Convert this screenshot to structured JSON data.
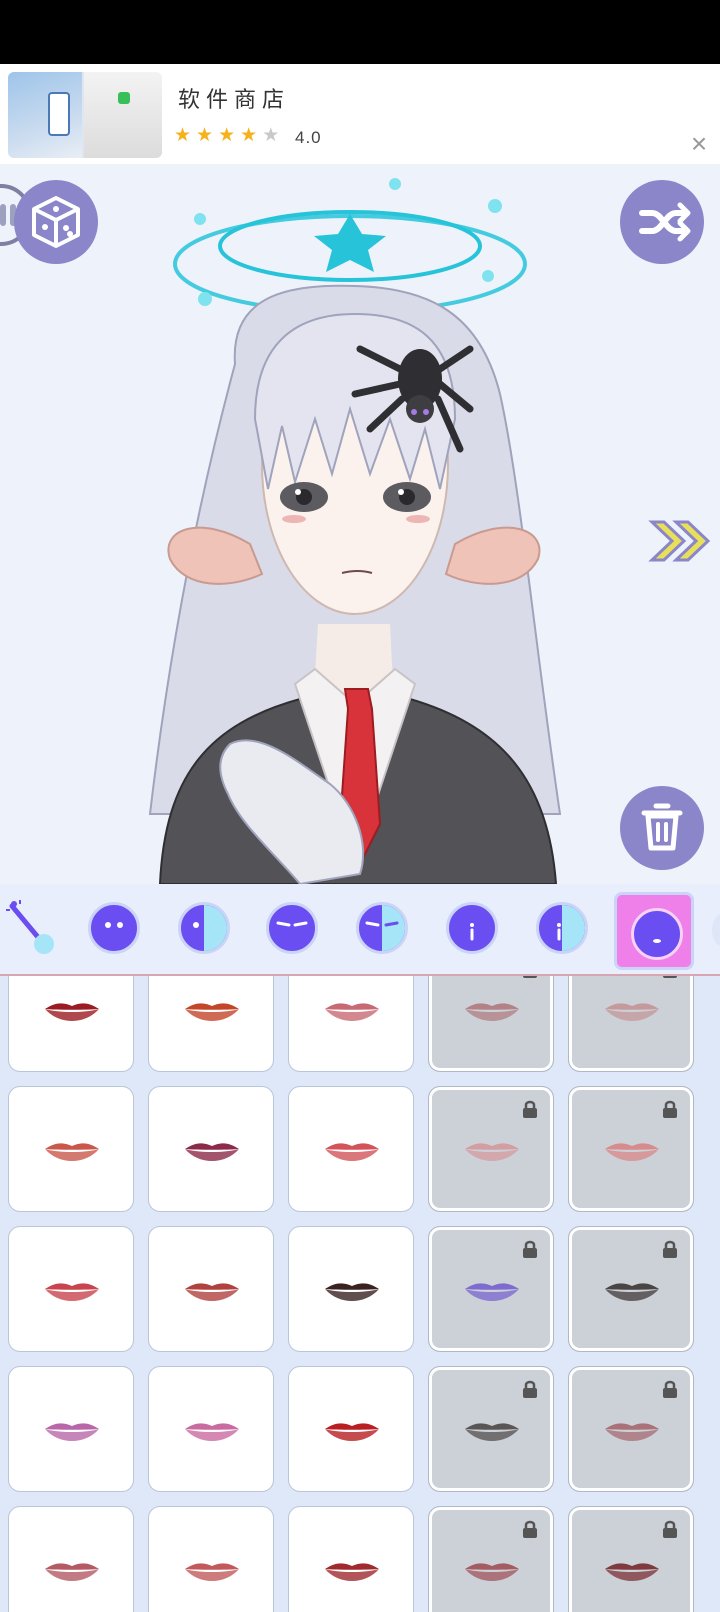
{
  "ad": {
    "title": "软件商店",
    "rating": "4.0",
    "stars_filled": 4,
    "stars_total": 5,
    "close_label": "×"
  },
  "stage": {
    "bg_color": "#eef3fb",
    "dice_icon": "dice-icon",
    "shuffle_icon": "shuffle-icon",
    "trash_icon": "trash-icon",
    "next_icon": "double-chevron-right-icon",
    "halo_color": "#27c3d9"
  },
  "toolbar": {
    "tools": [
      {
        "name": "magic-wand-tool",
        "icon": "magic-wand-icon"
      },
      {
        "name": "face-dots",
        "icon": "face-icon"
      },
      {
        "name": "face-half",
        "icon": "face-icon"
      },
      {
        "name": "face-brows",
        "icon": "face-icon"
      },
      {
        "name": "face-brows-half",
        "icon": "face-icon"
      },
      {
        "name": "face-nose",
        "icon": "face-icon"
      },
      {
        "name": "face-nose-half",
        "icon": "face-icon"
      },
      {
        "name": "face-mouth",
        "icon": "face-icon",
        "active": true
      }
    ],
    "active_color": "#ef7fe9"
  },
  "mouths": [
    {
      "color": "#9b1c22",
      "locked": false
    },
    {
      "color": "#c3452a",
      "locked": false
    },
    {
      "color": "#c86a74",
      "locked": false
    },
    {
      "color": "#b28287",
      "locked": true
    },
    {
      "color": "#c49a9c",
      "locked": true
    },
    {
      "color": "#c9584b",
      "locked": false
    },
    {
      "color": "#8c2a4a",
      "locked": false
    },
    {
      "color": "#d2545a",
      "locked": false
    },
    {
      "color": "#d39ea2",
      "locked": true
    },
    {
      "color": "#d88b8d",
      "locked": true
    },
    {
      "color": "#c9454d",
      "locked": false
    },
    {
      "color": "#b0413f",
      "locked": false
    },
    {
      "color": "#3a2222",
      "locked": false
    },
    {
      "color": "#7d6bd0",
      "locked": true
    },
    {
      "color": "#4a4444",
      "locked": true
    },
    {
      "color": "#b868a8",
      "locked": false
    },
    {
      "color": "#c96aa0",
      "locked": false
    },
    {
      "color": "#b81e22",
      "locked": false
    },
    {
      "color": "#5b5656",
      "locked": true
    },
    {
      "color": "#a87278",
      "locked": true
    },
    {
      "color": "#b45a64",
      "locked": false
    },
    {
      "color": "#c25a5c",
      "locked": false
    },
    {
      "color": "#9f2b2e",
      "locked": false
    },
    {
      "color": "#a45c63",
      "locked": true
    },
    {
      "color": "#7f3a3f",
      "locked": true
    }
  ]
}
